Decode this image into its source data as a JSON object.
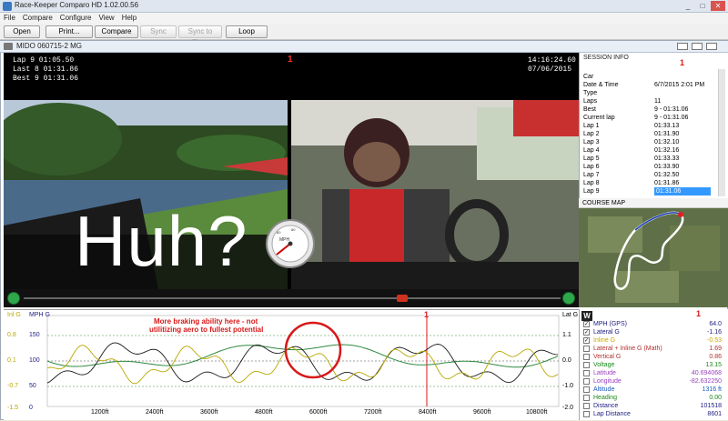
{
  "window": {
    "title": "Race-Keeper Comparo HD 1.02.00.56",
    "min": "_",
    "max": "□",
    "close": "✕"
  },
  "menu": [
    "File",
    "Compare",
    "Configure",
    "View",
    "Help"
  ],
  "toolbar": {
    "open": "Open",
    "print": "Print...",
    "compare": "Compare",
    "sync": "Sync",
    "sync_to_time": "Sync to Time",
    "loop": "Loop"
  },
  "document": {
    "title": "MIDO 060715-2 MG"
  },
  "video": {
    "laps": [
      "Lap 9   01:05.50",
      "Last 8   01:31.86",
      "Best 9   01:31.06"
    ],
    "clock": "14:16:24.60",
    "date": "07/06/2015",
    "marker": "1",
    "caption": "Huh?",
    "gauge_unit": "MPH",
    "gauge_ticks": [
      "20",
      "40",
      "60",
      "80",
      "100",
      "120",
      "140"
    ]
  },
  "session": {
    "title": "SESSION INFO",
    "marker": "1",
    "rows": [
      {
        "k": "Car",
        "v": ""
      },
      {
        "k": "Date & Time",
        "v": "6/7/2015 2:01 PM"
      },
      {
        "k": "Type",
        "v": ""
      },
      {
        "k": "Laps",
        "v": "11"
      },
      {
        "k": "Best",
        "v": "9 - 01:31.06"
      },
      {
        "k": "Current lap",
        "v": "9 - 01:31.06"
      },
      {
        "k": "Lap 1",
        "v": "01:33.13"
      },
      {
        "k": "Lap 2",
        "v": "01:31.90"
      },
      {
        "k": "Lap 3",
        "v": "01:32.10"
      },
      {
        "k": "Lap 4",
        "v": "01:32.16"
      },
      {
        "k": "Lap 5",
        "v": "01:33.33"
      },
      {
        "k": "Lap 6",
        "v": "01:33.90"
      },
      {
        "k": "Lap 7",
        "v": "01:32.50"
      },
      {
        "k": "Lap 8",
        "v": "01:31.86"
      },
      {
        "k": "Lap 9",
        "v": "01:31.06"
      }
    ]
  },
  "course_map": {
    "title": "COURSE MAP"
  },
  "graph": {
    "left_axis1": "Inl G",
    "left_axis2": "MPH G",
    "right_axis": "Lat G",
    "w_button": "W",
    "marker": "1",
    "annotation_line1": "More braking ability here - not",
    "annotation_line2": "utilitizing aero to fullest potential",
    "y_left_inl": [
      "0.8",
      "0.1",
      "-0.7",
      "-1.5"
    ],
    "y_left_mph": [
      "150",
      "100",
      "50",
      "0"
    ],
    "y_right": [
      "1.1",
      "0.0",
      "-1.0",
      "-2.0"
    ],
    "x_ticks": [
      "1200ft",
      "2400ft",
      "3600ft",
      "4800ft",
      "6000ft",
      "7200ft",
      "8400ft",
      "9600ft",
      "10800ft"
    ]
  },
  "channels": {
    "marker": "1",
    "rows": [
      {
        "name": "MPH (GPS)",
        "value": "64.0",
        "color": "#1a1a80",
        "checked": "✓"
      },
      {
        "name": "Lateral G",
        "value": "-1.16",
        "color": "#1a1a80",
        "checked": "✓"
      },
      {
        "name": "Inline G",
        "value": "-0.53",
        "color": "#c8a800",
        "checked": "✓"
      },
      {
        "name": "Lateral + Inline G (Math)",
        "value": "1.69",
        "color": "#b03030",
        "checked": ""
      },
      {
        "name": "Vertical G",
        "value": "0.86",
        "color": "#b03030",
        "checked": ""
      },
      {
        "name": "Voltage",
        "value": "13.15",
        "color": "#1a8a1a",
        "checked": ""
      },
      {
        "name": "Latitude",
        "value": "40.694068",
        "color": "#9a40c0",
        "checked": ""
      },
      {
        "name": "Longitude",
        "value": "-82.632250",
        "color": "#9a40c0",
        "checked": ""
      },
      {
        "name": "Altitude",
        "value": "1316 ft",
        "color": "#1a5ac0",
        "checked": ""
      },
      {
        "name": "Heading",
        "value": "0.00",
        "color": "#1a8a1a",
        "checked": ""
      },
      {
        "name": "Distance",
        "value": "101518",
        "color": "#1a1a80",
        "checked": ""
      },
      {
        "name": "Lap Distance",
        "value": "8601",
        "color": "#1a1a80",
        "checked": ""
      }
    ]
  },
  "colors": {
    "accent": "#3399ff",
    "trace_mph": "#1a1a1a",
    "trace_inline": "#b8a800",
    "trace_speed": "#2f8a3f",
    "annotation": "#d81818"
  }
}
